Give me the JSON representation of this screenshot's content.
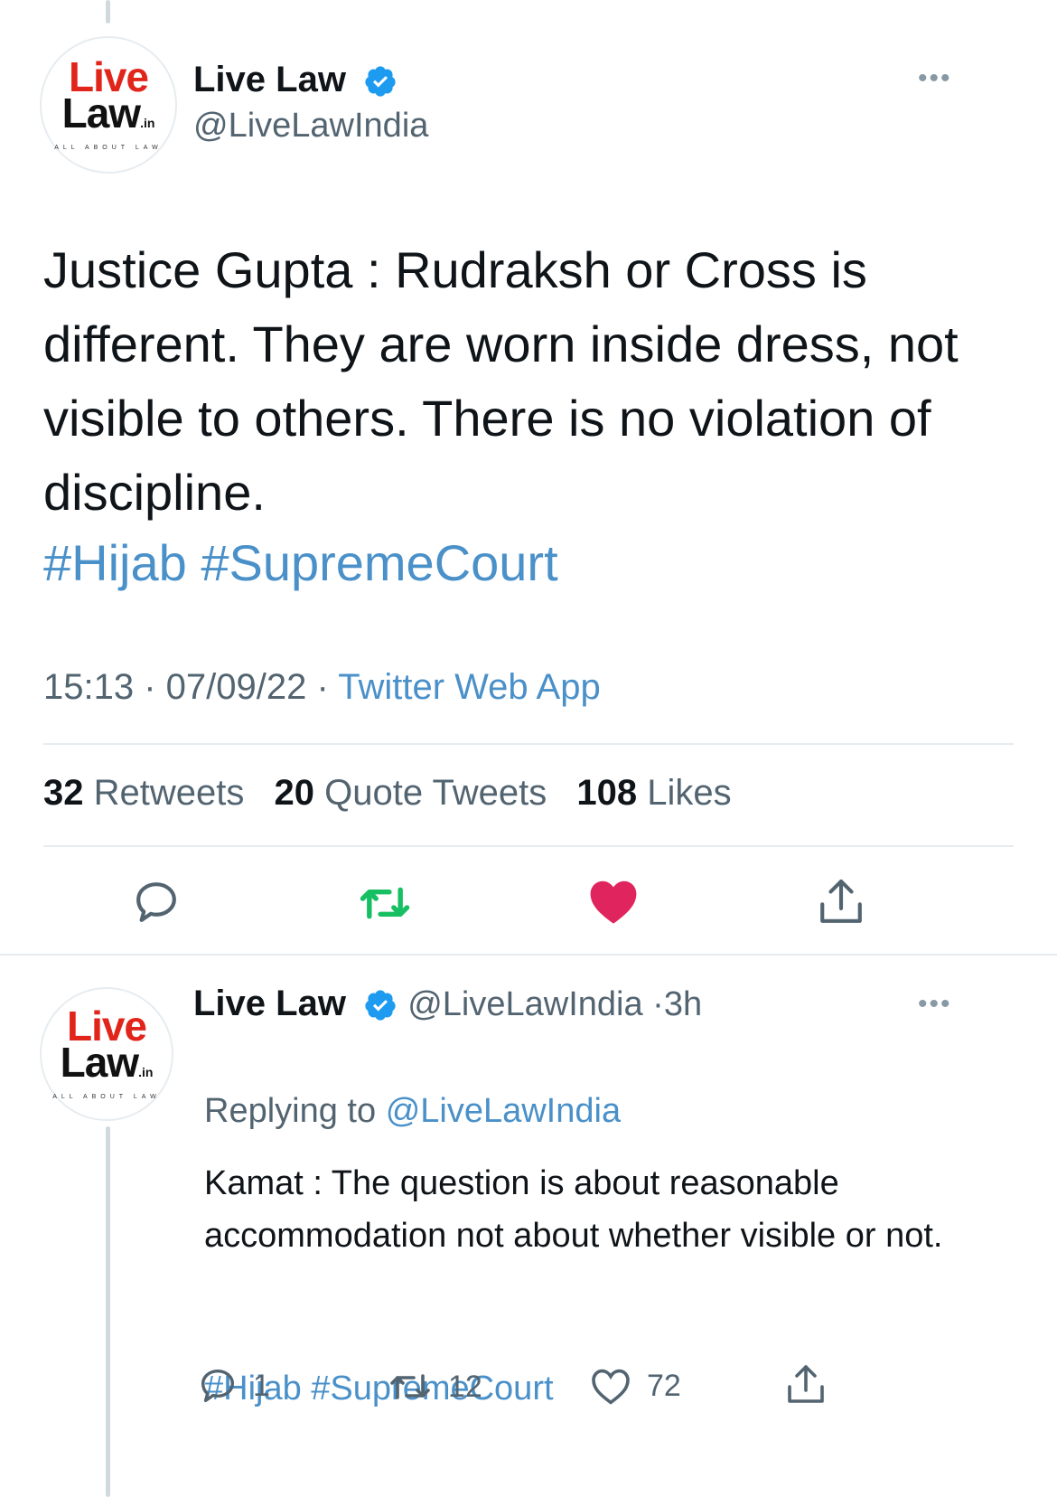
{
  "tweet": {
    "avatar_logo": {
      "line1": "Live",
      "line2": "Law",
      "suffix": ".in",
      "tagline": "ALL ABOUT LAW"
    },
    "name": "Live Law",
    "handle": "@LiveLawIndia",
    "more": "•••",
    "text": "Justice Gupta : Rudraksh or Cross is different. They are worn inside dress, not visible to others. There is no violation of discipline.",
    "hashtags": "#Hijab #SupremeCourt",
    "time": "15:13",
    "date": "07/09/22",
    "source": "Twitter Web App",
    "stats": {
      "retweets_count": "32",
      "retweets_label": "Retweets",
      "quotes_count": "20",
      "quotes_label": "Quote Tweets",
      "likes_count": "108",
      "likes_label": "Likes"
    }
  },
  "reply": {
    "avatar_logo": {
      "line1": "Live",
      "line2": "Law",
      "suffix": ".in",
      "tagline": "ALL ABOUT LAW"
    },
    "name": "Live Law",
    "handle": "@LiveLawIndia",
    "age": "3h",
    "more": "•••",
    "replying_prefix": "Replying to",
    "replying_to": "@LiveLawIndia",
    "text": "Kamat : The question is about reasonable accommodation not about whether visible or not.",
    "hashtags": "#Hijab #SupremeCourt",
    "reply_count": "1",
    "retweet_count": "12",
    "like_count": "72"
  },
  "colors": {
    "link": "#4a90c9",
    "retweet_green": "#17bf63",
    "like_pink": "#e0245e",
    "verified_blue": "#1d9bf0"
  }
}
